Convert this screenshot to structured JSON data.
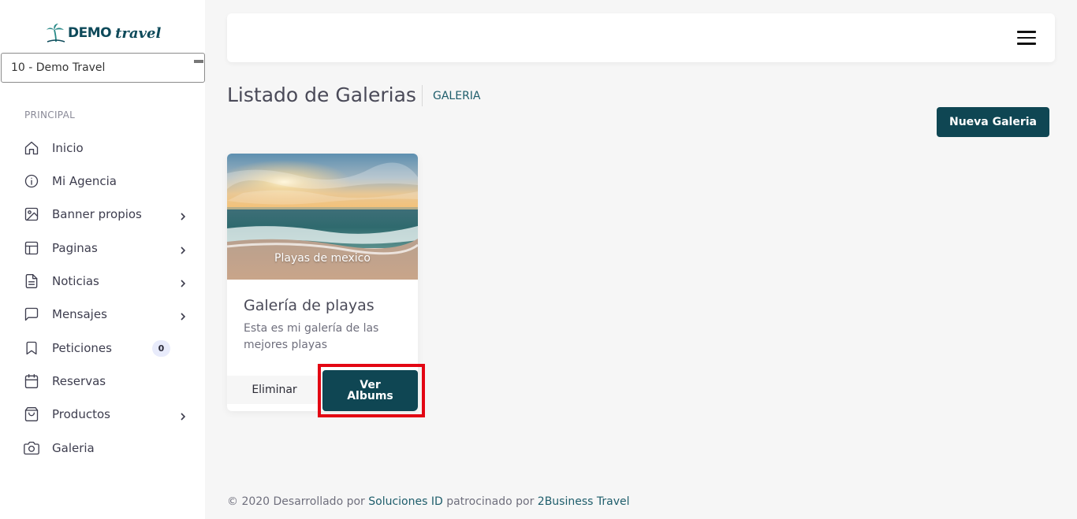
{
  "brand": {
    "bold": "DEMO",
    "script": "travel",
    "primary_color": "#0f4653"
  },
  "agency_select": {
    "value": "10 - Demo Travel"
  },
  "sidebar": {
    "section_label": "PRINCIPAL",
    "items": [
      {
        "label": "Inicio",
        "icon": "home-icon",
        "chevron": false
      },
      {
        "label": "Mi Agencia",
        "icon": "info-icon",
        "chevron": false
      },
      {
        "label": "Banner propios",
        "icon": "image-icon",
        "chevron": true
      },
      {
        "label": "Paginas",
        "icon": "layout-icon",
        "chevron": true
      },
      {
        "label": "Noticias",
        "icon": "document-icon",
        "chevron": true
      },
      {
        "label": "Mensajes",
        "icon": "message-icon",
        "chevron": true
      },
      {
        "label": "Peticiones",
        "icon": "bookmark-icon",
        "chevron": false,
        "badge": "0"
      },
      {
        "label": "Reservas",
        "icon": "calendar-icon",
        "chevron": false
      },
      {
        "label": "Productos",
        "icon": "shopping-bag-icon",
        "chevron": true
      },
      {
        "label": "Galeria",
        "icon": "camera-icon",
        "chevron": false
      }
    ]
  },
  "topbar": {
    "menu_icon": "hamburger-menu-icon"
  },
  "page": {
    "title": "Listado de Galerias",
    "breadcrumb": "GALERIA",
    "new_button": "Nueva Galeria"
  },
  "gallery_card": {
    "image_caption": "Playas de mexico",
    "title": "Galería de playas",
    "description": "Esta es mi galería de las mejores playas",
    "delete_button": "Eliminar",
    "view_button": "Ver Albums"
  },
  "footer": {
    "prefix": "© 2020 Desarrollado por",
    "link1": "Soluciones ID",
    "middle": "patrocinado por",
    "link2": "2Business Travel"
  }
}
